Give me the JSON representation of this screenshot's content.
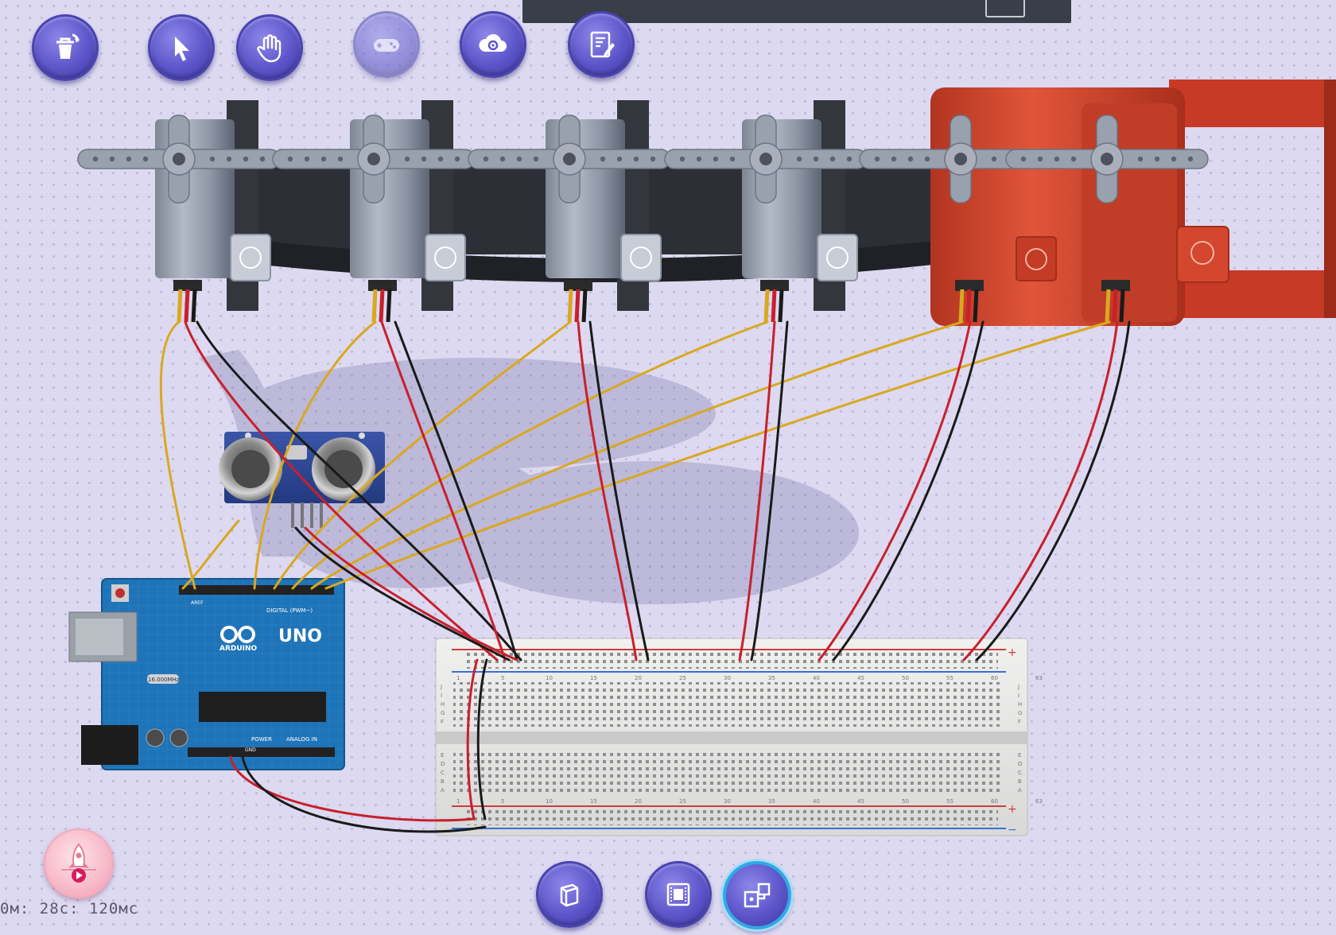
{
  "toolbar": {
    "buttons": [
      {
        "name": "delete-button",
        "icon": "trash-undo-icon"
      },
      {
        "name": "select-tool-button",
        "icon": "cursor-arrow-icon"
      },
      {
        "name": "pan-tool-button",
        "icon": "hand-icon"
      },
      {
        "name": "gamepad-button",
        "icon": "gamepad-icon",
        "state": "disabled"
      },
      {
        "name": "cloud-settings-button",
        "icon": "cloud-gear-icon"
      },
      {
        "name": "notes-button",
        "icon": "notepad-pencil-icon"
      }
    ]
  },
  "bottom_toolbar": {
    "buttons": [
      {
        "name": "3d-view-button",
        "icon": "cube-icon"
      },
      {
        "name": "schematic-view-button",
        "icon": "chip-icon"
      },
      {
        "name": "circuit-view-button",
        "icon": "circuit-blocks-icon",
        "state": "active"
      }
    ]
  },
  "simulation": {
    "run_icon": "rocket-play-icon",
    "timer": "0м: 28с: 120мс"
  },
  "arduino": {
    "logo": "UNO",
    "brand": "ARDUINO",
    "digital_label": "DIGITAL (PWM~)",
    "power_label": "POWER",
    "analog_label": "ANALOG IN",
    "crystal": "16.000MHz",
    "aref_label": "AREF",
    "gnd_label": "GND"
  },
  "breadboard": {
    "row_letters_top": [
      "J",
      "I",
      "H",
      "G",
      "F"
    ],
    "row_letters_bottom": [
      "E",
      "D",
      "C",
      "B",
      "A"
    ],
    "columns": [
      "1",
      "5",
      "10",
      "15",
      "20",
      "25",
      "30",
      "35",
      "40",
      "45",
      "50",
      "55",
      "60",
      "63"
    ],
    "rail_plus": "+",
    "rail_minus": "−"
  },
  "colors": {
    "toolbar_button": "#5c55c9",
    "active_ring": "#2fa9e6",
    "wire_signal": "#d9a820",
    "wire_power": "#c8202c",
    "wire_ground": "#1a1a1a",
    "robot_arm": "#d4462e",
    "arduino_board": "#1f73b7"
  }
}
